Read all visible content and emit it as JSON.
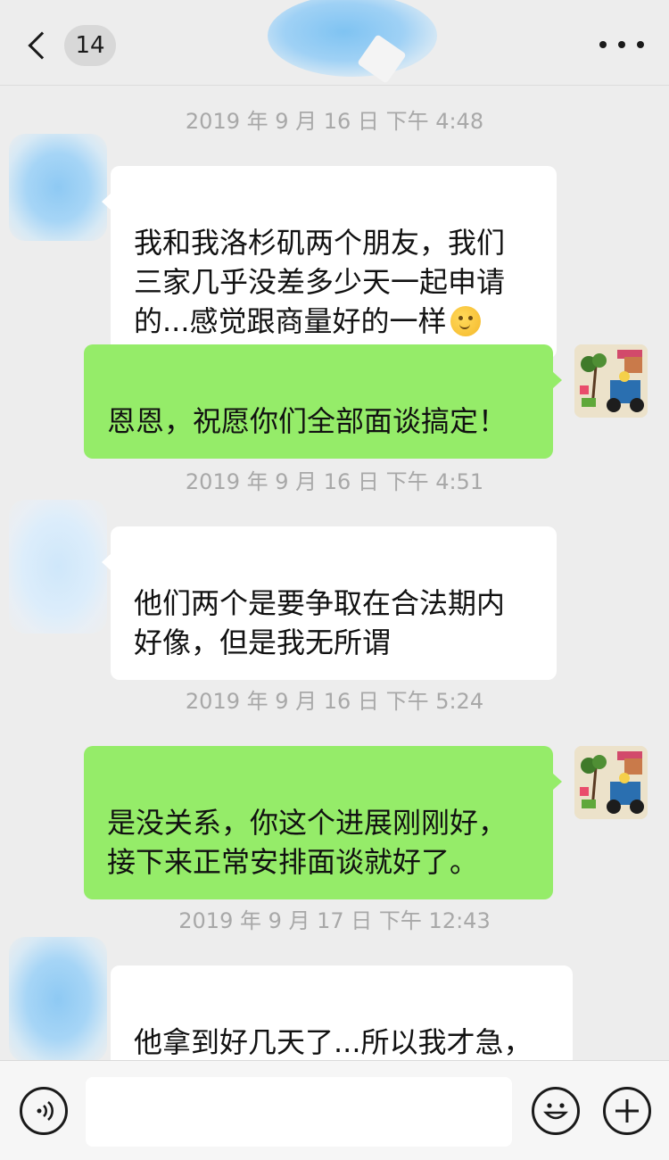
{
  "header": {
    "unread_count": "14",
    "back_icon": "chevron-left-icon",
    "more_icon": "more-dots-icon"
  },
  "messages": [
    {
      "type": "timestamp",
      "text": "2019 年 9 月 16 日  下午 4:48"
    },
    {
      "type": "incoming",
      "text": "我和我洛杉矶两个朋友，我们\n三家几乎没差多少天一起申请\n的...感觉跟商量好的一样",
      "emoji": "thinking-face-emoji"
    },
    {
      "type": "outgoing",
      "text": "恩恩，祝愿你们全部面谈搞定！"
    },
    {
      "type": "timestamp",
      "text": "2019 年 9 月 16 日  下午 4:51"
    },
    {
      "type": "incoming",
      "text": "他们两个是要争取在合法期内\n好像，但是我无所谓"
    },
    {
      "type": "timestamp",
      "text": "2019 年 9 月 16 日  下午 5:24"
    },
    {
      "type": "outgoing",
      "text": "是没关系，你这个进展刚刚好，\n接下来正常安排面谈就好了。"
    },
    {
      "type": "timestamp",
      "text": "2019 年 9 月 17 日  下午 12:43"
    },
    {
      "type": "incoming",
      "text": "他拿到好几天了...所以我才急，\n我比他还早打指纹"
    }
  ],
  "input_bar": {
    "voice_icon": "voice-icon",
    "emoji_icon": "smiley-icon",
    "plus_icon": "plus-icon",
    "placeholder": ""
  }
}
